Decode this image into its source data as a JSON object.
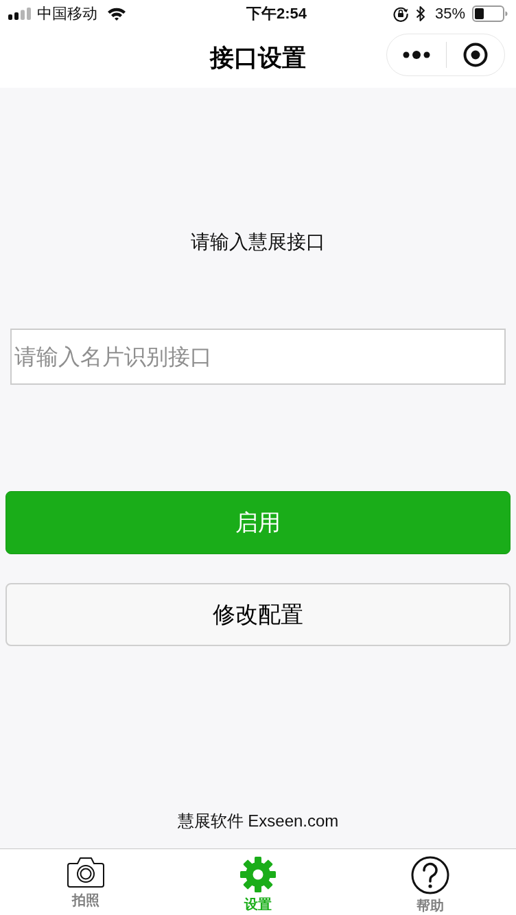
{
  "status_bar": {
    "carrier": "中国移动",
    "time": "下午2:54",
    "battery": "35%"
  },
  "nav_bar": {
    "title": "接口设置"
  },
  "form": {
    "label": "请输入慧展接口",
    "input": {
      "placeholder": "请输入名片识别接口"
    }
  },
  "buttons": [
    {
      "label": "启用",
      "kind": "primary"
    },
    {
      "label": "修改配置",
      "kind": "default"
    }
  ],
  "footer": "慧展软件 Exseen.com",
  "tab_bar": [
    {
      "label": "拍照",
      "selected": false
    },
    {
      "label": "设置",
      "selected": true
    },
    {
      "label": "帮助",
      "selected": false
    }
  ]
}
